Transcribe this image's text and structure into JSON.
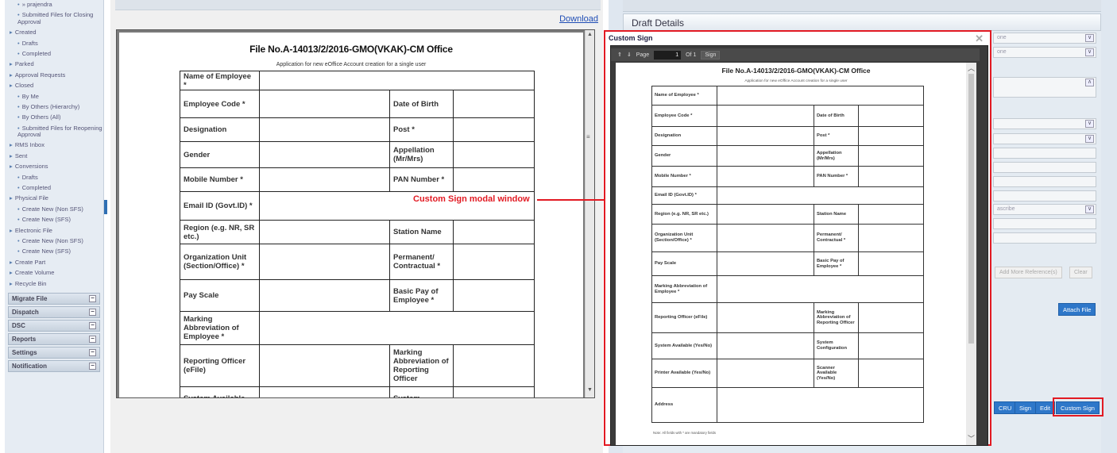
{
  "sidebar": {
    "links": [
      {
        "text": "» prajendra",
        "level": 1
      },
      {
        "text": "Submitted Files for Closing Approval",
        "level": 1
      },
      {
        "text": "Created",
        "level": 0
      },
      {
        "text": "Drafts",
        "level": 1
      },
      {
        "text": "Completed",
        "level": 1
      },
      {
        "text": "Parked",
        "level": 0
      },
      {
        "text": "Approval Requests",
        "level": 0
      },
      {
        "text": "Closed",
        "level": 0
      },
      {
        "text": "By Me",
        "level": 1
      },
      {
        "text": "By Others (Hierarchy)",
        "level": 1
      },
      {
        "text": "By Others (All)",
        "level": 1
      },
      {
        "text": "Submitted Files for Reopening Approval",
        "level": 1
      },
      {
        "text": "RMS Inbox",
        "level": 0
      },
      {
        "text": "Sent",
        "level": 0
      },
      {
        "text": "Conversions",
        "level": 0
      },
      {
        "text": "Drafts",
        "level": 1
      },
      {
        "text": "Completed",
        "level": 1
      },
      {
        "text": "Physical File",
        "level": 0
      },
      {
        "text": "Create New (Non SFS)",
        "level": 1
      },
      {
        "text": "Create New (SFS)",
        "level": 1
      },
      {
        "text": "Electronic File",
        "level": 0
      },
      {
        "text": "Create New (Non SFS)",
        "level": 1
      },
      {
        "text": "Create New (SFS)",
        "level": 1
      },
      {
        "text": "Create Part",
        "level": 0
      },
      {
        "text": "Create Volume",
        "level": 0
      },
      {
        "text": "Recycle Bin",
        "level": 0
      }
    ],
    "sections": [
      "Migrate File",
      "Dispatch",
      "DSC",
      "Reports",
      "Settings",
      "Notification"
    ]
  },
  "document": {
    "download_label": "Download",
    "title": "File No.A-14013/2/2016-GMO(VKAK)-CM Office",
    "subtitle": "Application for new eOffice Account creation for a single user",
    "rows": [
      {
        "label": "Name of Employee *"
      },
      {
        "label": "Employee Code *",
        "label2": "Date of Birth"
      },
      {
        "label": "Designation",
        "label2": "Post *"
      },
      {
        "label": "Gender",
        "label2": "Appellation (Mr/Mrs)"
      },
      {
        "label": "Mobile Number *",
        "label2": "PAN Number *"
      },
      {
        "label": "Email ID (Govt.ID) *"
      },
      {
        "label": "Region (e.g. NR, SR etc.)",
        "label2": "Station Name"
      },
      {
        "label": "Organization Unit (Section/Office) *",
        "label2": "Permanent/ Contractual *"
      },
      {
        "label": "Pay Scale",
        "label2": "Basic Pay of Employee *"
      },
      {
        "label": "Marking Abbreviation of Employee *"
      },
      {
        "label": "Reporting Officer (eFile)",
        "label2": "Marking Abbreviation of Reporting Officer"
      },
      {
        "label": "System Available",
        "label2": "System"
      }
    ]
  },
  "annotation": {
    "text": "Custom Sign modal window"
  },
  "modal": {
    "title": "Custom Sign",
    "close": "✕",
    "toolbar": {
      "page_label": "Page",
      "page_value": "1",
      "of_label": "Of 1",
      "sign_label": "Sign"
    },
    "doc_title": "File No.A-14013/2/2016-GMO(VKAK)-CM Office",
    "doc_subtitle": "Application for new eOffice Account creation for a single user",
    "rows": [
      {
        "label": "Name of Employee *"
      },
      {
        "label": "Employee Code *",
        "label2": "Date of Birth"
      },
      {
        "label": "Designation",
        "label2": "Post *"
      },
      {
        "label": "Gender",
        "label2": "Appellation (Mr/Mrs)"
      },
      {
        "label": "Mobile Number *",
        "label2": "PAN Number *"
      },
      {
        "label": "Email ID (Govt.ID) *"
      },
      {
        "label": "Region (e.g. NR, SR etc.)",
        "label2": "Station Name"
      },
      {
        "label": "Organization Unit (Section/Office) *",
        "label2": "Permanent/ Contractual *"
      },
      {
        "label": "Pay Scale",
        "label2": "Basic Pay of Employee *"
      },
      {
        "label": "Marking Abbreviation of Employee *"
      },
      {
        "label": "Reporting Officer (eFile)",
        "label2": "Marking Abbreviation of Reporting Officer"
      },
      {
        "label": "System Available (Yes/No)",
        "label2": "System Configuration"
      },
      {
        "label": "Printer Available (Yes/No)",
        "label2": "Scanner Available (Yes/No)"
      },
      {
        "label": "Address"
      }
    ],
    "note": "Note: All fields with * are mandatory fields"
  },
  "right_panel": {
    "section_title": "Draft Details",
    "field_text_1": "one",
    "field_text_2": "one",
    "field_text_3": "ascribe",
    "attach_label": "Attach File",
    "add_more_label": "Add More Reference(s)",
    "clear_label": "Clear",
    "buttons": [
      "CRU",
      "Sign",
      "Edit",
      "Custom Sign"
    ]
  }
}
